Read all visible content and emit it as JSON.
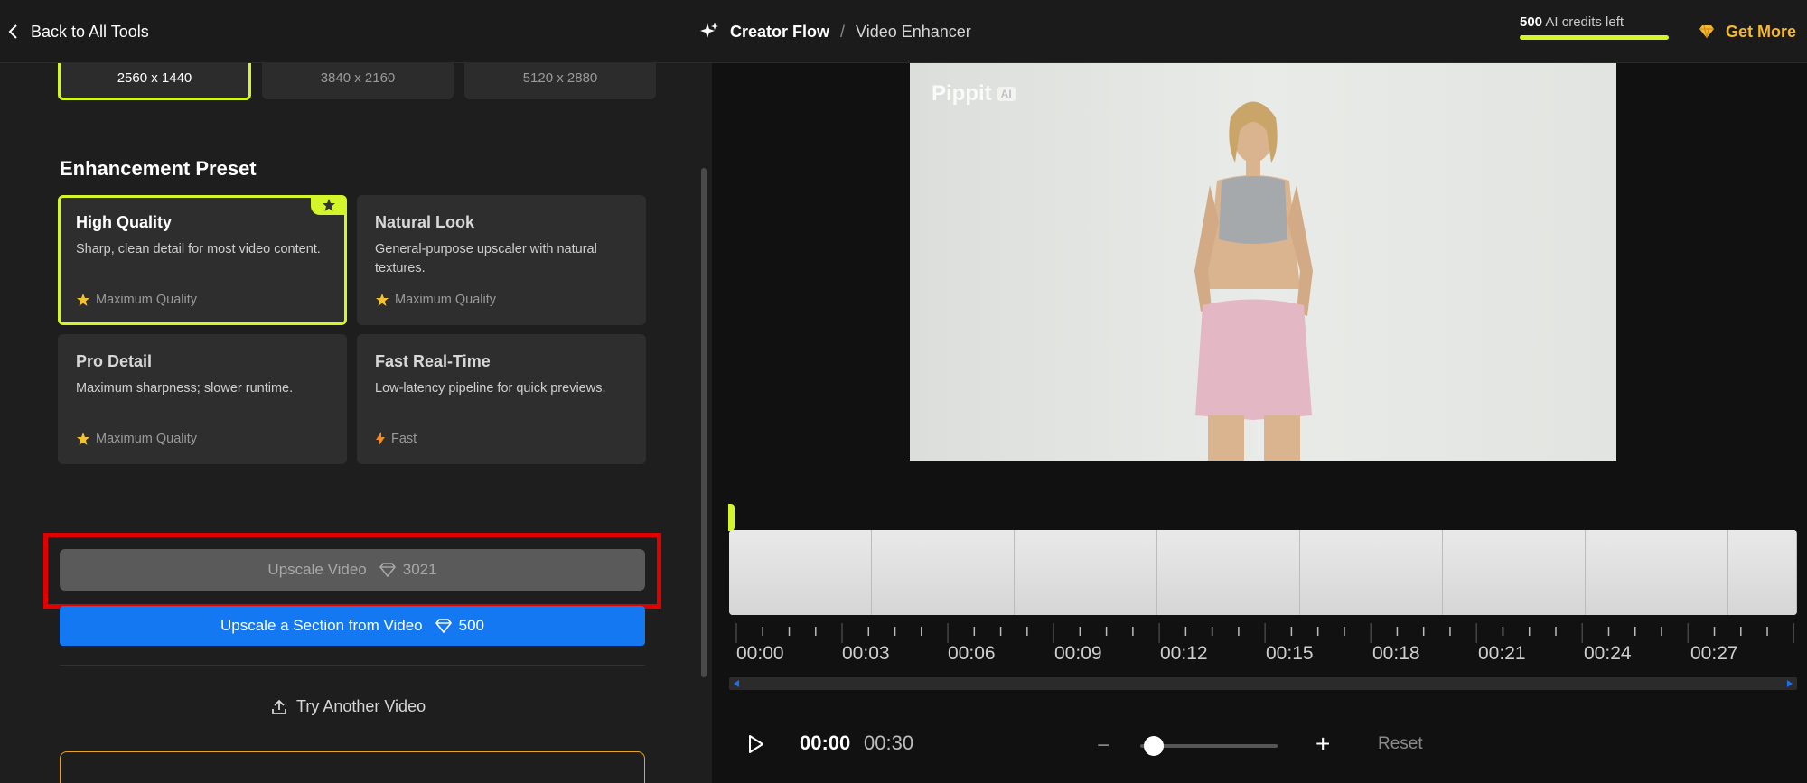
{
  "header": {
    "back_label": "Back to All Tools",
    "crumb_parent": "Creator Flow",
    "crumb_sep": "/",
    "crumb_current": "Video Enhancer",
    "credits_count": "500",
    "credits_label": "AI credits left",
    "get_more_label": "Get More",
    "accent_color": "#d4f52a",
    "gold_color": "#f5b82e"
  },
  "resolutions": [
    {
      "label": "2560 x 1440",
      "selected": true
    },
    {
      "label": "3840 x 2160",
      "selected": false
    },
    {
      "label": "5120 x 2880",
      "selected": false
    }
  ],
  "preset": {
    "section_title": "Enhancement Preset",
    "cards": [
      {
        "title": "High Quality",
        "desc": "Sharp, clean detail for most video content.",
        "tag": "Maximum Quality",
        "tag_icon": "star-icon",
        "selected": true
      },
      {
        "title": "Natural Look",
        "desc": "General-purpose upscaler with natural textures.",
        "tag": "Maximum Quality",
        "tag_icon": "star-icon",
        "selected": false
      },
      {
        "title": "Pro Detail",
        "desc": "Maximum sharpness; slower runtime.",
        "tag": "Maximum Quality",
        "tag_icon": "star-icon",
        "selected": false
      },
      {
        "title": "Fast Real-Time",
        "desc": "Low-latency pipeline for quick previews.",
        "tag": "Fast",
        "tag_icon": "lightning-icon",
        "selected": false
      }
    ]
  },
  "actions": {
    "upscale_label": "Upscale Video",
    "upscale_cost": "3021",
    "section_label": "Upscale a Section from Video",
    "section_cost": "500",
    "try_another_label": "Try Another Video"
  },
  "preview": {
    "watermark": "Pippit",
    "watermark_badge": "AI"
  },
  "timeline": {
    "ticks": [
      "00:00",
      "00:03",
      "00:06",
      "00:09",
      "00:12",
      "00:15",
      "00:18",
      "00:21",
      "00:24",
      "00:27"
    ]
  },
  "player": {
    "current_time": "00:00",
    "total_time": "00:30",
    "zoom_minus": "−",
    "zoom_plus": "+",
    "reset_label": "Reset"
  }
}
